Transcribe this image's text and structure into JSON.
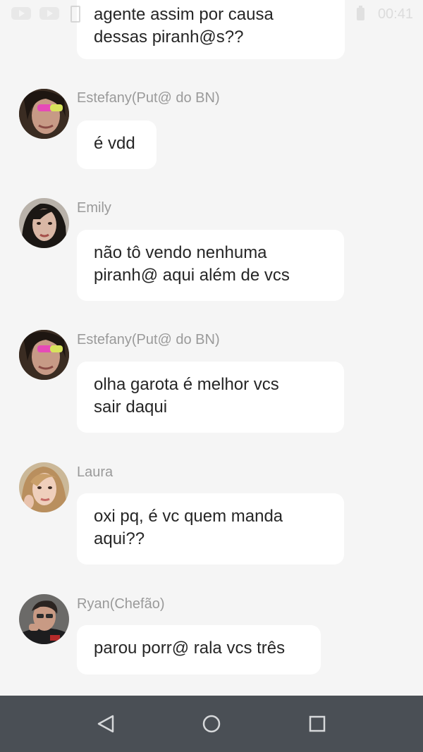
{
  "status_bar": {
    "time": "00:41",
    "icons": [
      "youtube-icon",
      "youtube-icon",
      "screenshot-icon",
      "battery-icon"
    ]
  },
  "messages": [
    {
      "sender": "",
      "avatar": "",
      "lines": [
        "agente assim por causa",
        "dessas piranh@s??"
      ]
    },
    {
      "sender": "Estefany(Put@ do BN)",
      "avatar": "estefany-avatar",
      "lines": [
        "é vdd"
      ]
    },
    {
      "sender": "Emily",
      "avatar": "emily-avatar",
      "lines": [
        "não tô vendo nenhuma",
        "piranh@ aqui além de vcs"
      ]
    },
    {
      "sender": "Estefany(Put@ do BN)",
      "avatar": "estefany-avatar",
      "lines": [
        "olha garota é melhor vcs",
        "sair daqui"
      ]
    },
    {
      "sender": "Laura",
      "avatar": "laura-avatar",
      "lines": [
        "oxi pq, é vc quem manda",
        "aqui??"
      ]
    },
    {
      "sender": "Ryan(Chefão)",
      "avatar": "ryan-avatar",
      "lines": [
        "parou porr@ rala vcs três"
      ]
    }
  ],
  "nav_bar": {
    "buttons": [
      "back-icon",
      "home-icon",
      "recents-icon"
    ]
  },
  "colors": {
    "background": "#f5f5f5",
    "bubble": "#ffffff",
    "sender_name": "#9a9a9a",
    "message_text": "#262626",
    "nav_bar": "#4a4f55",
    "nav_icon": "#d6d8da"
  }
}
